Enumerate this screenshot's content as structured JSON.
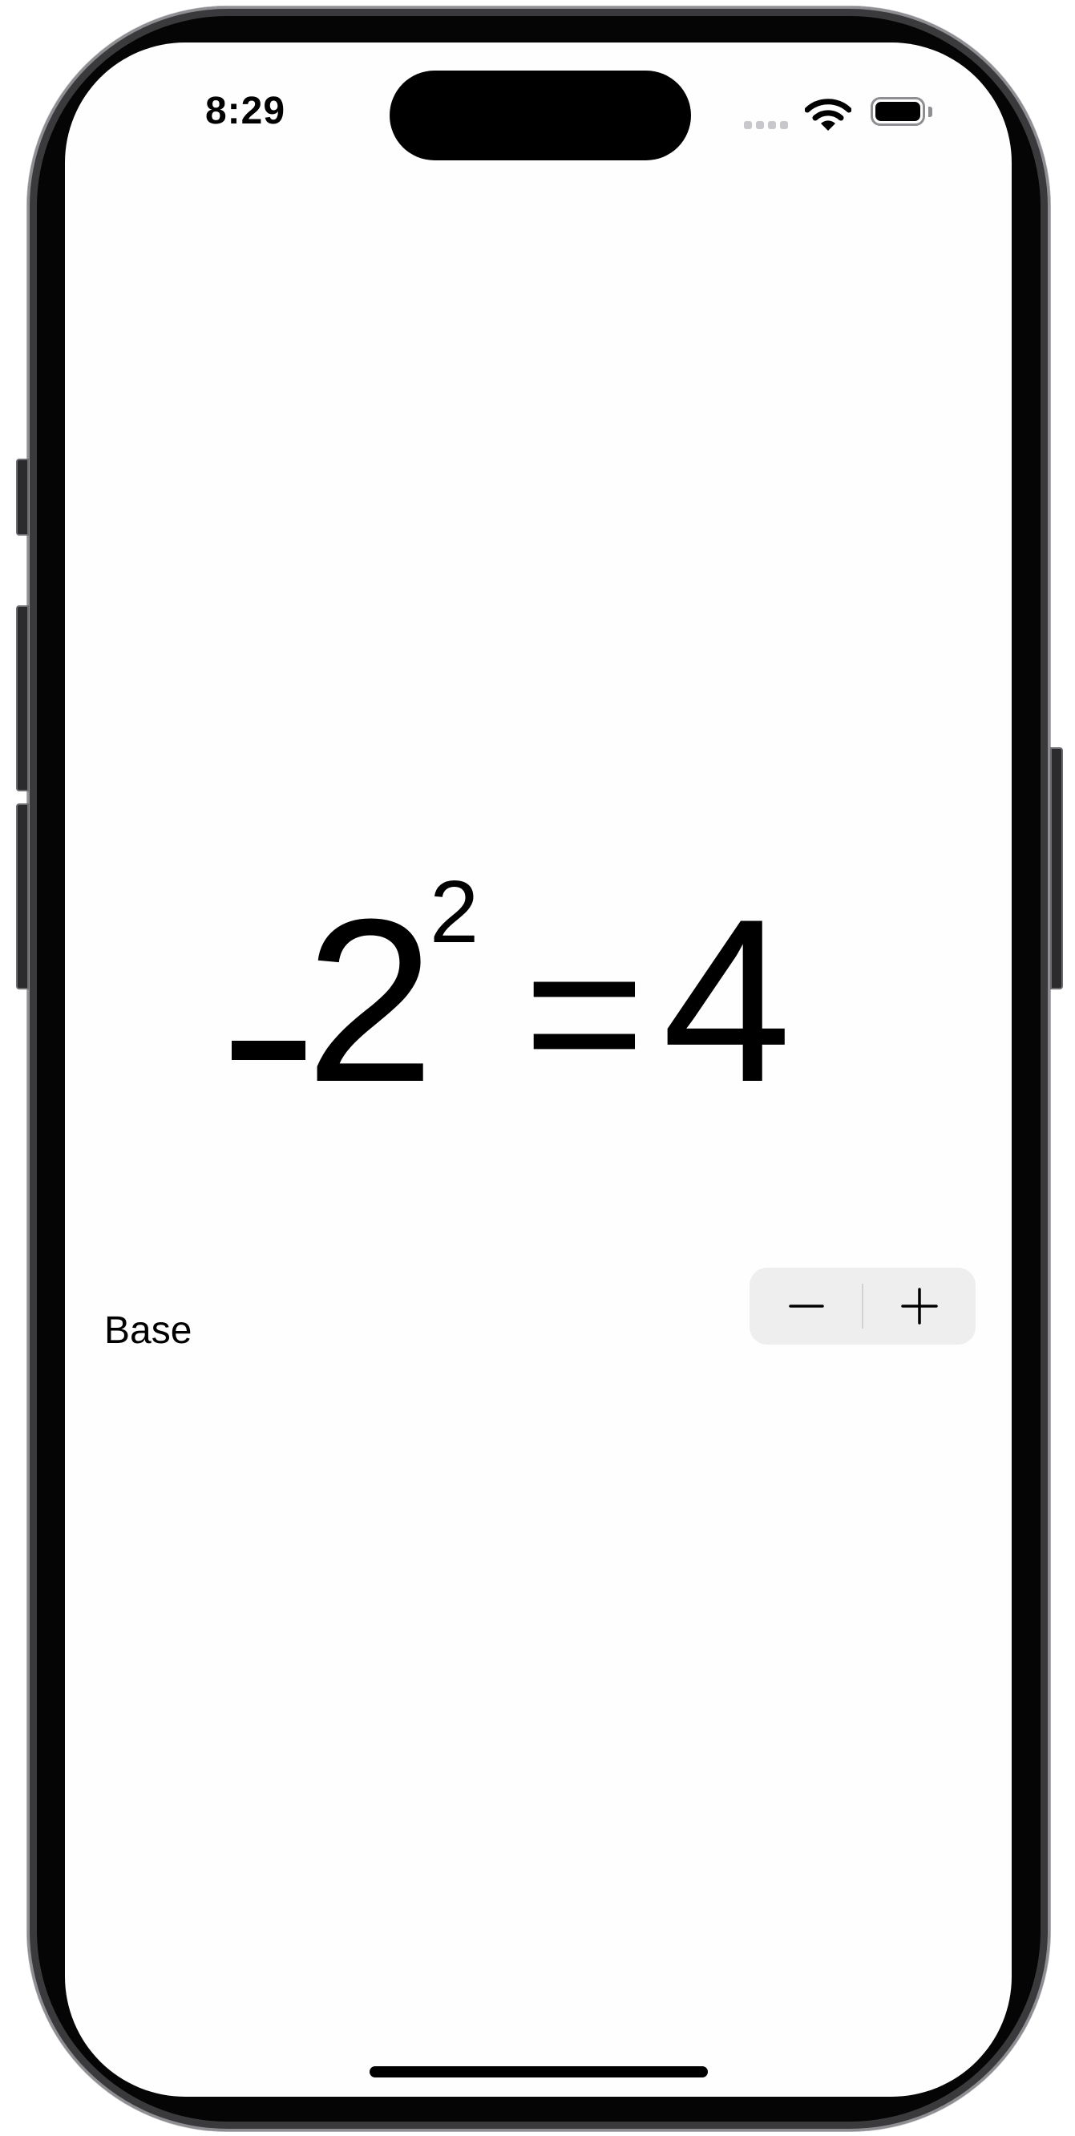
{
  "status_bar": {
    "time": "8:29",
    "wifi_icon": "wifi-icon",
    "battery_icon": "battery-icon",
    "signal_icon": "cellular-signal-icon"
  },
  "equation": {
    "base": "2",
    "exponent": "2",
    "equals": "=",
    "result": "4"
  },
  "controls": {
    "label": "Base",
    "decrement_icon": "minus-icon",
    "increment_icon": "plus-icon"
  }
}
